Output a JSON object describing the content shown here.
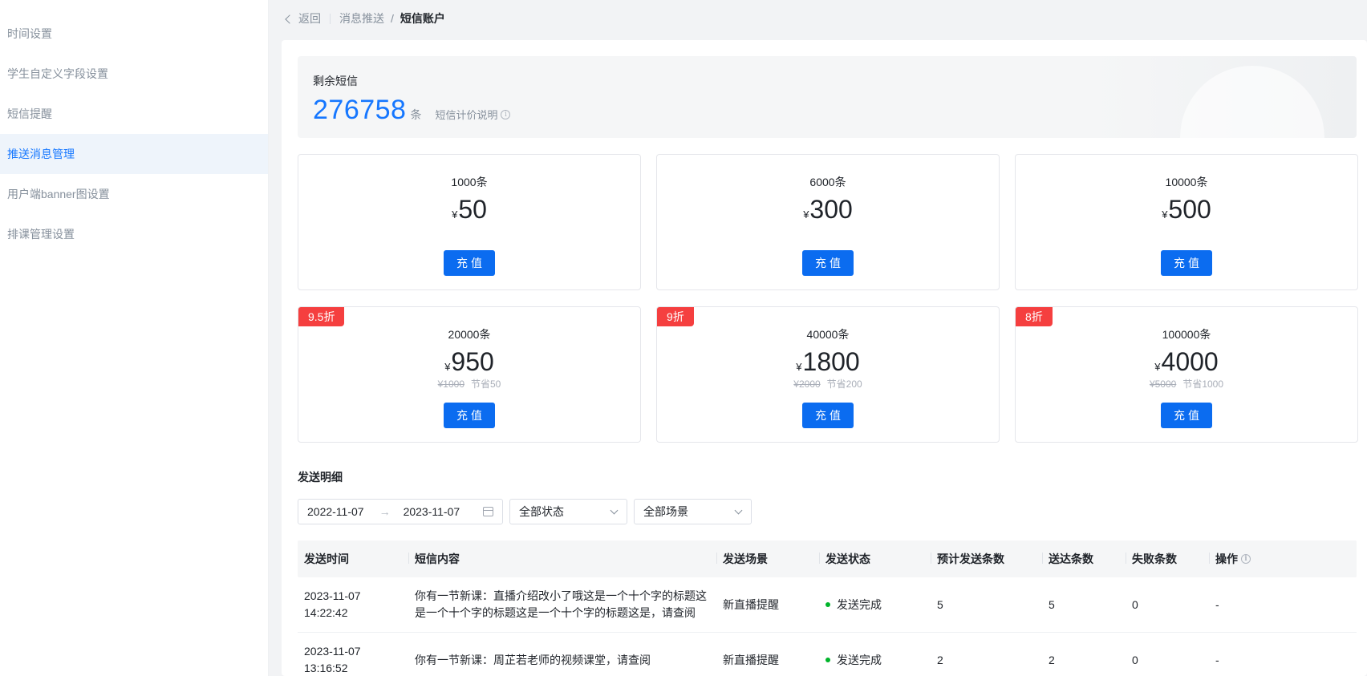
{
  "sidebar": {
    "items": [
      {
        "label": "时间设置",
        "active": false
      },
      {
        "label": "学生自定义字段设置",
        "active": false
      },
      {
        "label": "短信提醒",
        "active": false
      },
      {
        "label": "推送消息管理",
        "active": true
      },
      {
        "label": "用户端banner图设置",
        "active": false
      },
      {
        "label": "排课管理设置",
        "active": false
      }
    ]
  },
  "breadcrumb": {
    "back_label": "返回",
    "parent": "消息推送",
    "separator": "/",
    "current": "短信账户"
  },
  "balance": {
    "label": "剩余短信",
    "count": "276758",
    "unit": "条",
    "pricing_link": "短信计价说明",
    "info_glyph": "i"
  },
  "packages": [
    {
      "qty": "1000条",
      "currency": "¥",
      "price": "50",
      "badge": "",
      "original": "",
      "saving": "",
      "button": "充值"
    },
    {
      "qty": "6000条",
      "currency": "¥",
      "price": "300",
      "badge": "",
      "original": "",
      "saving": "",
      "button": "充值"
    },
    {
      "qty": "10000条",
      "currency": "¥",
      "price": "500",
      "badge": "",
      "original": "",
      "saving": "",
      "button": "充值"
    },
    {
      "qty": "20000条",
      "currency": "¥",
      "price": "950",
      "badge": "9.5折",
      "original": "¥1000",
      "saving": "节省50",
      "button": "充值"
    },
    {
      "qty": "40000条",
      "currency": "¥",
      "price": "1800",
      "badge": "9折",
      "original": "¥2000",
      "saving": "节省200",
      "button": "充值"
    },
    {
      "qty": "100000条",
      "currency": "¥",
      "price": "4000",
      "badge": "8折",
      "original": "¥5000",
      "saving": "节省1000",
      "button": "充值"
    }
  ],
  "details": {
    "title": "发送明细",
    "date_start": "2022-11-07",
    "date_sep": "→",
    "date_end": "2023-11-07",
    "status_filter": "全部状态",
    "scene_filter": "全部场景"
  },
  "table": {
    "columns": [
      "发送时间",
      "短信内容",
      "发送场景",
      "发送状态",
      "预计发送条数",
      "送达条数",
      "失败条数",
      "操作"
    ],
    "rows": [
      {
        "time_date": "2023-11-07",
        "time_clock": "14:22:42",
        "content": "你有一节新课：直播介绍改小了哦这是一个十个字的标题这是一个十个字的标题这是一个十个字的标题这是，请查阅",
        "scene": "新直播提醒",
        "status": "发送完成",
        "expected": "5",
        "delivered": "5",
        "failed": "0",
        "action": "-"
      },
      {
        "time_date": "2023-11-07",
        "time_clock": "13:16:52",
        "content": "你有一节新课：周芷若老师的视频课堂，请查阅",
        "scene": "新直播提醒",
        "status": "发送完成",
        "expected": "2",
        "delivered": "2",
        "failed": "0",
        "action": "-"
      }
    ]
  },
  "colors": {
    "accent": "#0b6cf0",
    "badge": "#f53f3f",
    "success": "#00b42a"
  }
}
